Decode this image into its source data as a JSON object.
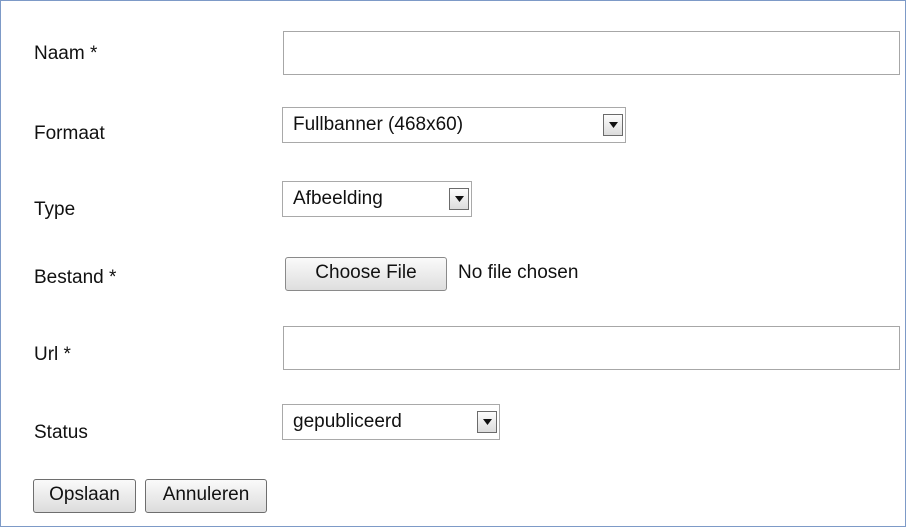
{
  "form": {
    "naam": {
      "label": "Naam *",
      "value": ""
    },
    "formaat": {
      "label": "Formaat",
      "selected": "Fullbanner (468x60)"
    },
    "type": {
      "label": "Type",
      "selected": "Afbeelding"
    },
    "bestand": {
      "label": "Bestand *",
      "button_label": "Choose File",
      "status": "No file chosen"
    },
    "url": {
      "label": "Url *",
      "value": ""
    },
    "status": {
      "label": "Status",
      "selected": "gepubliceerd"
    }
  },
  "actions": {
    "save_label": "Opslaan",
    "cancel_label": "Annuleren"
  }
}
